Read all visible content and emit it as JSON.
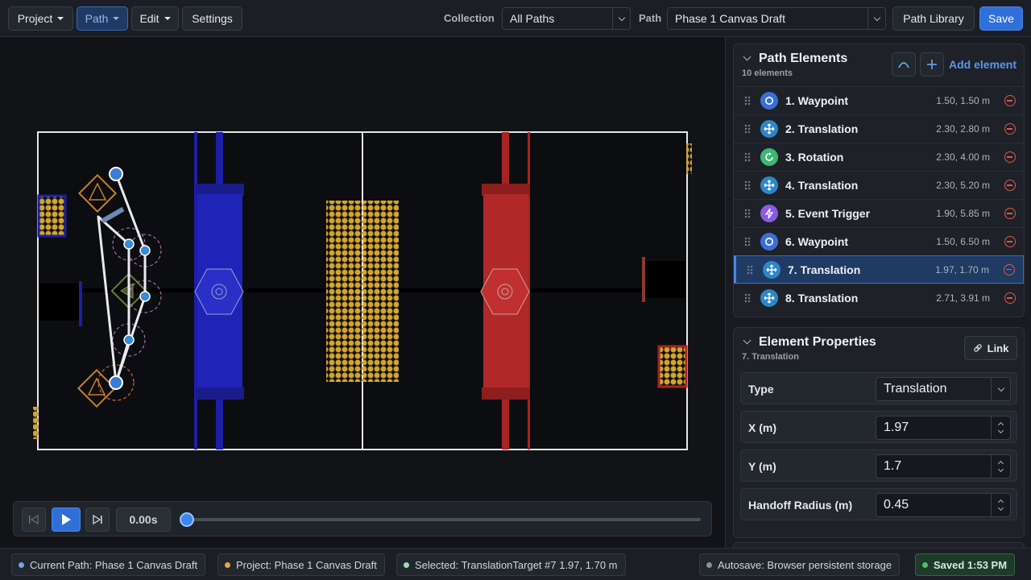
{
  "menu": {
    "project": "Project",
    "path": "Path",
    "edit": "Edit",
    "settings": "Settings"
  },
  "toolbar": {
    "collection_label": "Collection",
    "collection_value": "All Paths",
    "path_label": "Path",
    "path_value": "Phase 1 Canvas Draft",
    "library_button": "Path Library",
    "save_button": "Save"
  },
  "playback": {
    "time": "0.00s",
    "progress": 0
  },
  "path_elements": {
    "title": "Path Elements",
    "count": "10 elements",
    "add_label": "Add element",
    "items": [
      {
        "label": "1. Waypoint",
        "coords": "1.50, 1.50 m",
        "icon": "waypoint-icon"
      },
      {
        "label": "2. Translation",
        "coords": "2.30, 2.80 m",
        "icon": "translation-icon"
      },
      {
        "label": "3. Rotation",
        "coords": "2.30, 4.00 m",
        "icon": "rotation-icon"
      },
      {
        "label": "4. Translation",
        "coords": "2.30, 5.20 m",
        "icon": "translation-icon"
      },
      {
        "label": "5. Event Trigger",
        "coords": "1.90, 5.85 m",
        "icon": "event-trigger-icon"
      },
      {
        "label": "6. Waypoint",
        "coords": "1.50, 6.50 m",
        "icon": "waypoint-icon"
      },
      {
        "label": "7. Translation",
        "coords": "1.97, 1.70 m",
        "icon": "translation-icon",
        "selected": true
      },
      {
        "label": "8. Translation",
        "coords": "2.71, 3.91 m",
        "icon": "translation-icon"
      }
    ]
  },
  "properties": {
    "title": "Element Properties",
    "subtitle": "7. Translation",
    "link_label": "Link",
    "type_label": "Type",
    "type_value": "Translation",
    "x_label": "X (m)",
    "x_value": "1.97",
    "y_label": "Y (m)",
    "y_value": "1.7",
    "radius_label": "Handoff Radius (m)",
    "radius_value": "0.45"
  },
  "status": {
    "current_path": "Current Path: Phase 1 Canvas Draft",
    "project": "Project: Phase 1 Canvas Draft",
    "selected": "Selected: TranslationTarget #7 1.97, 1.70 m",
    "autosave": "Autosave: Browser persistent storage",
    "saved": "Saved 1:53 PM"
  },
  "colors": {
    "accent": "#2f6fd8",
    "blue_alliance": "#1c1fa8",
    "red_alliance": "#a82424",
    "fuel": "#d4a630",
    "remove": "#e0574a",
    "saved_dot": "#4cc06a"
  }
}
